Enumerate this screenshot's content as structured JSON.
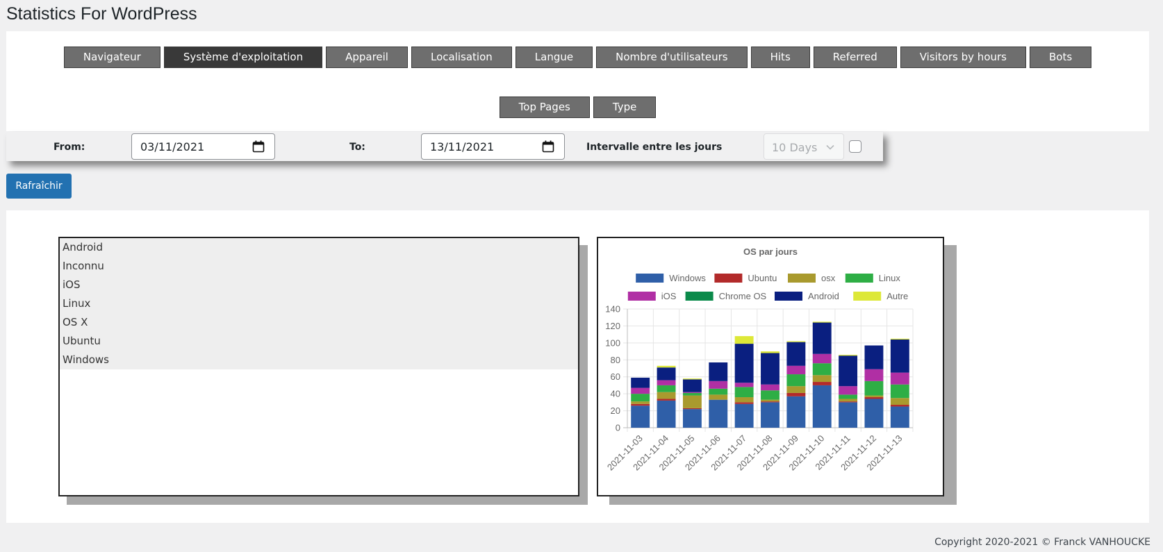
{
  "page": {
    "title": "Statistics For WordPress"
  },
  "tabs": {
    "row1": [
      {
        "label": "Navigateur",
        "active": false
      },
      {
        "label": "Système d'exploitation",
        "active": true
      },
      {
        "label": "Appareil",
        "active": false
      },
      {
        "label": "Localisation",
        "active": false
      },
      {
        "label": "Langue",
        "active": false
      },
      {
        "label": "Nombre d'utilisateurs",
        "active": false
      },
      {
        "label": "Hits",
        "active": false
      },
      {
        "label": "Referred",
        "active": false
      },
      {
        "label": "Visitors by hours",
        "active": false
      },
      {
        "label": "Bots",
        "active": false
      }
    ],
    "row2": [
      {
        "label": "Top Pages",
        "active": false
      },
      {
        "label": "Type",
        "active": false
      }
    ]
  },
  "filters": {
    "from_label": "From:",
    "from_value": "03/11/2021",
    "to_label": "To:",
    "to_value": "13/11/2021",
    "interval_label": "Intervalle entre les jours",
    "interval_value": "10 Days",
    "interval_checked": false
  },
  "refresh_label": "Rafraîchir",
  "os_list": [
    "Android",
    "Inconnu",
    "iOS",
    "Linux",
    "OS X",
    "Ubuntu",
    "Windows"
  ],
  "chart_data": {
    "type": "bar",
    "stacked": true,
    "title": "OS par jours",
    "legend_position": "top",
    "ylim": [
      0,
      140
    ],
    "yticks": [
      0,
      20,
      40,
      60,
      80,
      100,
      120,
      140
    ],
    "grid": true,
    "categories": [
      "2021-11-03",
      "2021-11-04",
      "2021-11-05",
      "2021-11-06",
      "2021-11-07",
      "2021-11-08",
      "2021-11-09",
      "2021-11-10",
      "2021-11-11",
      "2021-11-12",
      "2021-11-13"
    ],
    "series": [
      {
        "name": "Windows",
        "color": "#2f5fa8",
        "values": [
          26,
          32,
          22,
          33,
          28,
          30,
          37,
          50,
          30,
          34,
          25
        ]
      },
      {
        "name": "Ubuntu",
        "color": "#b22a2a",
        "values": [
          2,
          2,
          1,
          0,
          2,
          1,
          4,
          4,
          1,
          2,
          2
        ]
      },
      {
        "name": "osx",
        "color": "#a99a2e",
        "values": [
          3,
          8,
          15,
          6,
          6,
          2,
          8,
          8,
          3,
          2,
          8
        ]
      },
      {
        "name": "Linux",
        "color": "#2eae45",
        "values": [
          9,
          8,
          3,
          7,
          12,
          11,
          14,
          14,
          5,
          17,
          16
        ]
      },
      {
        "name": "iOS",
        "color": "#b02fa4",
        "values": [
          7,
          6,
          1,
          9,
          5,
          7,
          10,
          11,
          10,
          14,
          14
        ]
      },
      {
        "name": "Chrome OS",
        "color": "#0a8a4a",
        "values": [
          0,
          0,
          0,
          0,
          0,
          0,
          0,
          0,
          0,
          0,
          0
        ]
      },
      {
        "name": "Android",
        "color": "#0a1f80",
        "values": [
          12,
          15,
          15,
          22,
          46,
          37,
          28,
          37,
          36,
          28,
          39
        ]
      },
      {
        "name": "Autre",
        "color": "#dde838",
        "values": [
          0,
          2,
          1,
          0,
          9,
          2,
          1,
          1,
          1,
          0,
          1
        ]
      }
    ]
  },
  "footer": {
    "copyright": "Copyright 2020-2021 © Franck VANHOUCKE"
  }
}
